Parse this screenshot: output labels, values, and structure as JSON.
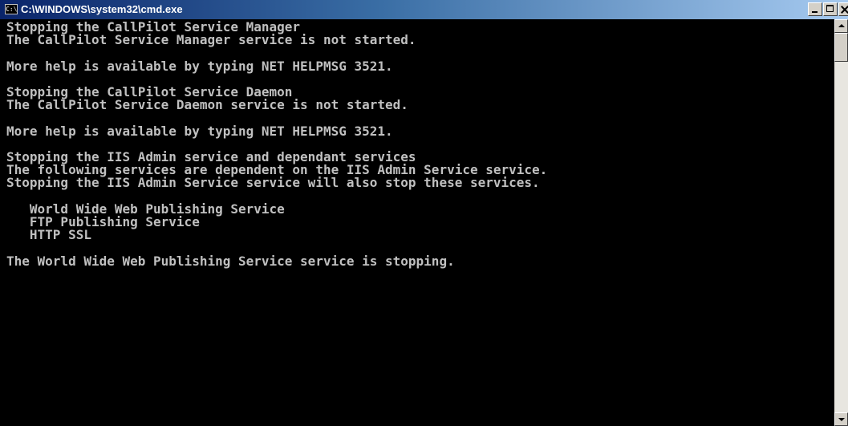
{
  "window": {
    "title": "C:\\WINDOWS\\system32\\cmd.exe",
    "icon_label": "C:\\",
    "icon": "console-icon"
  },
  "caption_buttons": {
    "minimize": "minimize-icon",
    "maximize": "maximize-icon",
    "close": "close-icon"
  },
  "console": {
    "text_color": "#c0c0c0",
    "background_color": "#000000",
    "lines": [
      "Stopping the CallPilot Service Manager",
      "The CallPilot Service Manager service is not started.",
      "",
      "More help is available by typing NET HELPMSG 3521.",
      "",
      "Stopping the CallPilot Service Daemon",
      "The CallPilot Service Daemon service is not started.",
      "",
      "More help is available by typing NET HELPMSG 3521.",
      "",
      "Stopping the IIS Admin service and dependant services",
      "The following services are dependent on the IIS Admin Service service.",
      "Stopping the IIS Admin Service service will also stop these services.",
      "",
      "   World Wide Web Publishing Service",
      "   FTP Publishing Service",
      "   HTTP SSL",
      "",
      "The World Wide Web Publishing Service service is stopping."
    ]
  },
  "scrollbar": {
    "up_icon": "scroll-up-arrow-icon",
    "down_icon": "scroll-down-arrow-icon",
    "position_fraction": 0.0
  }
}
